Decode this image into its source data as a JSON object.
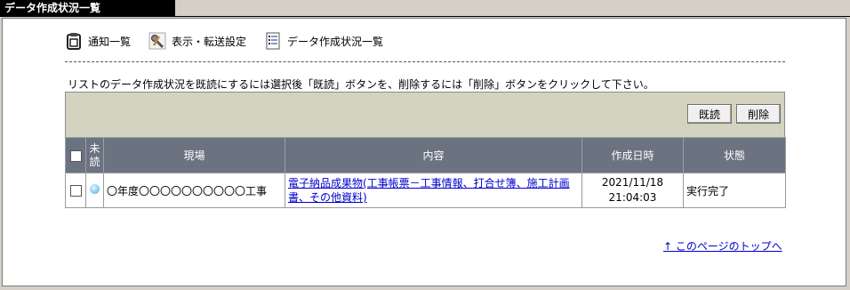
{
  "window": {
    "title": "データ作成状況一覧"
  },
  "toolbar": {
    "items": [
      {
        "label": "通知一覧",
        "icon": "clipboard-icon"
      },
      {
        "label": "表示・転送設定",
        "icon": "settings-tools-icon"
      },
      {
        "label": "データ作成状況一覧",
        "icon": "list-icon"
      }
    ]
  },
  "instruction": "リストのデータ作成状況を既読にするには選択後「既読」ボタンを、削除するには「削除」ボタンをクリックして下さい。",
  "actions": {
    "read_label": "既読",
    "delete_label": "削除"
  },
  "table": {
    "headers": {
      "unread": "未\n読",
      "site": "現場",
      "content": "内容",
      "created": "作成日時",
      "status": "状態"
    },
    "rows": [
      {
        "site": "〇年度〇〇〇〇〇〇〇〇〇〇工事",
        "content": "電子納品成果物(工事帳票－工事情報、打合せ簿、施工計画書、その他資料)",
        "created": "2021/11/18 21:04:03",
        "status": "実行完了"
      }
    ]
  },
  "footer": {
    "top_link": "このページのトップへ"
  }
}
